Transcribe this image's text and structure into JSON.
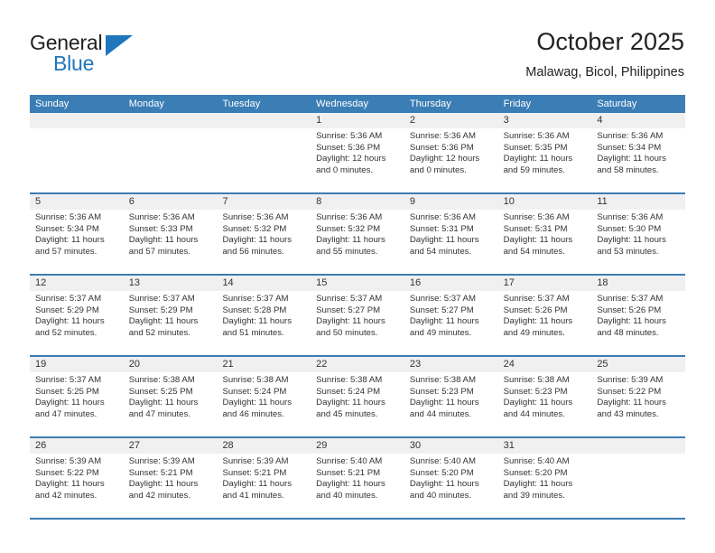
{
  "logo": {
    "word1": "General",
    "word2": "Blue",
    "triangle_color": "#1f76bc"
  },
  "header": {
    "title": "October 2025",
    "subtitle": "Malawag, Bicol, Philippines"
  },
  "theme": {
    "header_blue": "#3b7db5",
    "date_band": "#f0f0f0",
    "text": "#333333"
  },
  "calendar": {
    "weekday_headers": [
      "Sunday",
      "Monday",
      "Tuesday",
      "Wednesday",
      "Thursday",
      "Friday",
      "Saturday"
    ],
    "weeks": [
      [
        {
          "day": "",
          "sunrise": "",
          "sunset": "",
          "daylight1": "",
          "daylight2": ""
        },
        {
          "day": "",
          "sunrise": "",
          "sunset": "",
          "daylight1": "",
          "daylight2": ""
        },
        {
          "day": "",
          "sunrise": "",
          "sunset": "",
          "daylight1": "",
          "daylight2": ""
        },
        {
          "day": "1",
          "sunrise": "Sunrise: 5:36 AM",
          "sunset": "Sunset: 5:36 PM",
          "daylight1": "Daylight: 12 hours",
          "daylight2": "and 0 minutes."
        },
        {
          "day": "2",
          "sunrise": "Sunrise: 5:36 AM",
          "sunset": "Sunset: 5:36 PM",
          "daylight1": "Daylight: 12 hours",
          "daylight2": "and 0 minutes."
        },
        {
          "day": "3",
          "sunrise": "Sunrise: 5:36 AM",
          "sunset": "Sunset: 5:35 PM",
          "daylight1": "Daylight: 11 hours",
          "daylight2": "and 59 minutes."
        },
        {
          "day": "4",
          "sunrise": "Sunrise: 5:36 AM",
          "sunset": "Sunset: 5:34 PM",
          "daylight1": "Daylight: 11 hours",
          "daylight2": "and 58 minutes."
        }
      ],
      [
        {
          "day": "5",
          "sunrise": "Sunrise: 5:36 AM",
          "sunset": "Sunset: 5:34 PM",
          "daylight1": "Daylight: 11 hours",
          "daylight2": "and 57 minutes."
        },
        {
          "day": "6",
          "sunrise": "Sunrise: 5:36 AM",
          "sunset": "Sunset: 5:33 PM",
          "daylight1": "Daylight: 11 hours",
          "daylight2": "and 57 minutes."
        },
        {
          "day": "7",
          "sunrise": "Sunrise: 5:36 AM",
          "sunset": "Sunset: 5:32 PM",
          "daylight1": "Daylight: 11 hours",
          "daylight2": "and 56 minutes."
        },
        {
          "day": "8",
          "sunrise": "Sunrise: 5:36 AM",
          "sunset": "Sunset: 5:32 PM",
          "daylight1": "Daylight: 11 hours",
          "daylight2": "and 55 minutes."
        },
        {
          "day": "9",
          "sunrise": "Sunrise: 5:36 AM",
          "sunset": "Sunset: 5:31 PM",
          "daylight1": "Daylight: 11 hours",
          "daylight2": "and 54 minutes."
        },
        {
          "day": "10",
          "sunrise": "Sunrise: 5:36 AM",
          "sunset": "Sunset: 5:31 PM",
          "daylight1": "Daylight: 11 hours",
          "daylight2": "and 54 minutes."
        },
        {
          "day": "11",
          "sunrise": "Sunrise: 5:36 AM",
          "sunset": "Sunset: 5:30 PM",
          "daylight1": "Daylight: 11 hours",
          "daylight2": "and 53 minutes."
        }
      ],
      [
        {
          "day": "12",
          "sunrise": "Sunrise: 5:37 AM",
          "sunset": "Sunset: 5:29 PM",
          "daylight1": "Daylight: 11 hours",
          "daylight2": "and 52 minutes."
        },
        {
          "day": "13",
          "sunrise": "Sunrise: 5:37 AM",
          "sunset": "Sunset: 5:29 PM",
          "daylight1": "Daylight: 11 hours",
          "daylight2": "and 52 minutes."
        },
        {
          "day": "14",
          "sunrise": "Sunrise: 5:37 AM",
          "sunset": "Sunset: 5:28 PM",
          "daylight1": "Daylight: 11 hours",
          "daylight2": "and 51 minutes."
        },
        {
          "day": "15",
          "sunrise": "Sunrise: 5:37 AM",
          "sunset": "Sunset: 5:27 PM",
          "daylight1": "Daylight: 11 hours",
          "daylight2": "and 50 minutes."
        },
        {
          "day": "16",
          "sunrise": "Sunrise: 5:37 AM",
          "sunset": "Sunset: 5:27 PM",
          "daylight1": "Daylight: 11 hours",
          "daylight2": "and 49 minutes."
        },
        {
          "day": "17",
          "sunrise": "Sunrise: 5:37 AM",
          "sunset": "Sunset: 5:26 PM",
          "daylight1": "Daylight: 11 hours",
          "daylight2": "and 49 minutes."
        },
        {
          "day": "18",
          "sunrise": "Sunrise: 5:37 AM",
          "sunset": "Sunset: 5:26 PM",
          "daylight1": "Daylight: 11 hours",
          "daylight2": "and 48 minutes."
        }
      ],
      [
        {
          "day": "19",
          "sunrise": "Sunrise: 5:37 AM",
          "sunset": "Sunset: 5:25 PM",
          "daylight1": "Daylight: 11 hours",
          "daylight2": "and 47 minutes."
        },
        {
          "day": "20",
          "sunrise": "Sunrise: 5:38 AM",
          "sunset": "Sunset: 5:25 PM",
          "daylight1": "Daylight: 11 hours",
          "daylight2": "and 47 minutes."
        },
        {
          "day": "21",
          "sunrise": "Sunrise: 5:38 AM",
          "sunset": "Sunset: 5:24 PM",
          "daylight1": "Daylight: 11 hours",
          "daylight2": "and 46 minutes."
        },
        {
          "day": "22",
          "sunrise": "Sunrise: 5:38 AM",
          "sunset": "Sunset: 5:24 PM",
          "daylight1": "Daylight: 11 hours",
          "daylight2": "and 45 minutes."
        },
        {
          "day": "23",
          "sunrise": "Sunrise: 5:38 AM",
          "sunset": "Sunset: 5:23 PM",
          "daylight1": "Daylight: 11 hours",
          "daylight2": "and 44 minutes."
        },
        {
          "day": "24",
          "sunrise": "Sunrise: 5:38 AM",
          "sunset": "Sunset: 5:23 PM",
          "daylight1": "Daylight: 11 hours",
          "daylight2": "and 44 minutes."
        },
        {
          "day": "25",
          "sunrise": "Sunrise: 5:39 AM",
          "sunset": "Sunset: 5:22 PM",
          "daylight1": "Daylight: 11 hours",
          "daylight2": "and 43 minutes."
        }
      ],
      [
        {
          "day": "26",
          "sunrise": "Sunrise: 5:39 AM",
          "sunset": "Sunset: 5:22 PM",
          "daylight1": "Daylight: 11 hours",
          "daylight2": "and 42 minutes."
        },
        {
          "day": "27",
          "sunrise": "Sunrise: 5:39 AM",
          "sunset": "Sunset: 5:21 PM",
          "daylight1": "Daylight: 11 hours",
          "daylight2": "and 42 minutes."
        },
        {
          "day": "28",
          "sunrise": "Sunrise: 5:39 AM",
          "sunset": "Sunset: 5:21 PM",
          "daylight1": "Daylight: 11 hours",
          "daylight2": "and 41 minutes."
        },
        {
          "day": "29",
          "sunrise": "Sunrise: 5:40 AM",
          "sunset": "Sunset: 5:21 PM",
          "daylight1": "Daylight: 11 hours",
          "daylight2": "and 40 minutes."
        },
        {
          "day": "30",
          "sunrise": "Sunrise: 5:40 AM",
          "sunset": "Sunset: 5:20 PM",
          "daylight1": "Daylight: 11 hours",
          "daylight2": "and 40 minutes."
        },
        {
          "day": "31",
          "sunrise": "Sunrise: 5:40 AM",
          "sunset": "Sunset: 5:20 PM",
          "daylight1": "Daylight: 11 hours",
          "daylight2": "and 39 minutes."
        },
        {
          "day": "",
          "sunrise": "",
          "sunset": "",
          "daylight1": "",
          "daylight2": ""
        }
      ]
    ]
  }
}
